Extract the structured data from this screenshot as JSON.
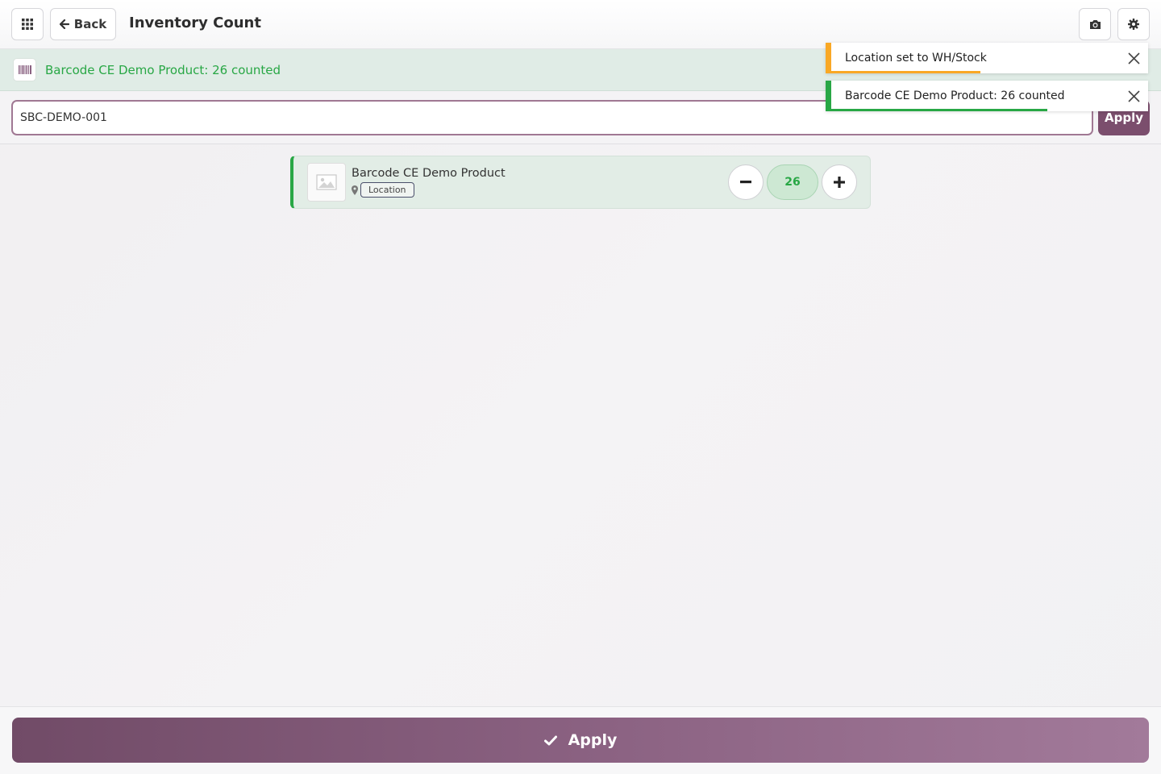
{
  "header": {
    "apps_icon": "grid-icon",
    "back_label": "Back",
    "title": "Inventory Count",
    "camera_icon": "camera-icon",
    "settings_icon": "gear-icon"
  },
  "banner": {
    "icon": "barcode-icon",
    "message": "Barcode CE Demo Product: 26 counted",
    "color": "#28a745"
  },
  "barcode_input": {
    "value": "SBC-DEMO-001",
    "apply_label": "Apply"
  },
  "line": {
    "product_name": "Barcode CE Demo Product",
    "location_badge": "Location",
    "quantity": "26",
    "decrement": "−",
    "increment": "+"
  },
  "toasts": [
    {
      "message": "Location set to WH/Stock",
      "color": "#f9a825",
      "progress": 0.45
    },
    {
      "message": "Barcode CE Demo Product: 26 counted",
      "color": "#28a745",
      "progress": 0.67
    }
  ],
  "footer": {
    "apply_label": "Apply",
    "accent": "#714b67"
  }
}
